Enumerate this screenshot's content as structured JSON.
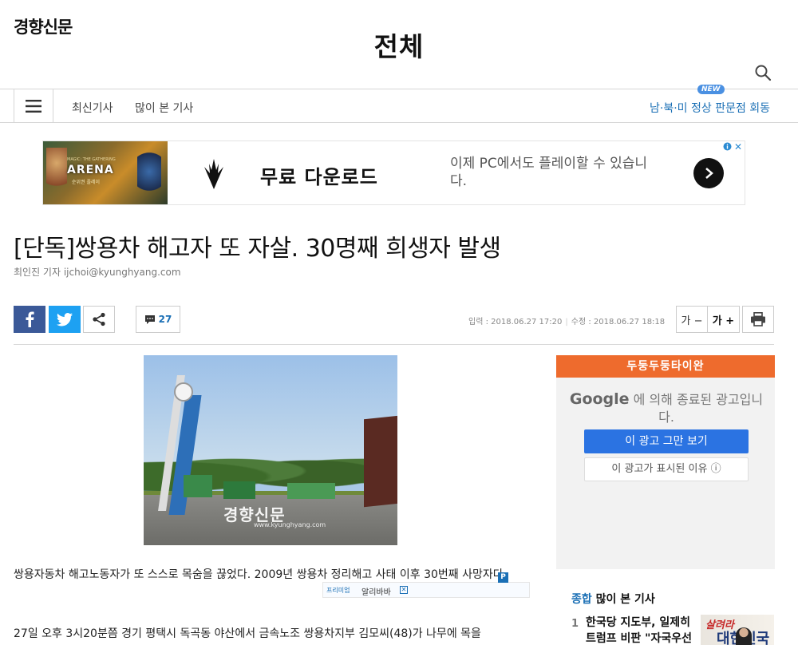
{
  "header": {
    "logo": "경향신문",
    "section_title": "전체"
  },
  "nav": {
    "latest": "최신기사",
    "most_viewed": "많이 본 기사",
    "hot_topic": "남·북·미 정상 판문점 회동",
    "new_badge": "NEW"
  },
  "banner_ad": {
    "image_text": "ARENA",
    "image_top_text": "MAGIC: THE GATHERING",
    "image_sub_text": "순위권 플레이",
    "headline": "무료 다운로드",
    "description": "이제 PC에서도 플레이할 수 있습니다.",
    "close": "✕"
  },
  "article": {
    "headline": "[단독]쌍용차 해고자 또 자살. 30명째 희생자 발생",
    "byline": "최인진 기자 ijchoi@kyunghyang.com",
    "comment_count": "27",
    "date_input": "입력 : 2018.06.27 17:20",
    "date_modified": "수정 : 2018.06.27 18:18",
    "font_decrease": "가 −",
    "font_increase": "가 +",
    "photo_watermark": "경향신문",
    "photo_watermark_url": "www.kyunghyang.com",
    "paragraph1": "쌍용자동차 해고노동자가 또 스스로 목숨을 끊었다. 2009년 쌍용차 정리해고 사태 이후 30번째 사망자다.",
    "paragraph2": "27일 오후 3시20분쯤 경기 평택시 독곡동 야산에서 금속노조 쌍용차지부 김모씨(48)가 나무에 목을"
  },
  "inline_ad": {
    "tag": "프리미엄",
    "name": "알리바바",
    "close": "✕",
    "p_label": "P"
  },
  "side_ad": {
    "top_text": "두둥두둥타이완",
    "google": "Google",
    "message": "에 의해 종료된 광고입니다.",
    "stop_button": "이 광고 그만 보기",
    "why_button": "이 광고가 표시된 이유 ⓘ"
  },
  "popular": {
    "category": "종합",
    "title": "많이 본 기사",
    "items": [
      {
        "num": "1",
        "text": "한국당 지도부, 일제히 트럼프 비판 \"자국우선",
        "thumb_text1": "살려라",
        "thumb_text2": "대한민국"
      }
    ]
  },
  "colors": {
    "facebook": "#3b5998",
    "twitter": "#1da1f2",
    "accent_blue": "#1a6fb5",
    "side_ad_orange": "#ee6b2d",
    "google_button": "#2b73e2"
  },
  "icons": {
    "search": "search-icon",
    "menu": "hamburger-icon",
    "facebook": "facebook-icon",
    "twitter": "twitter-icon",
    "share": "share-icon",
    "comment": "comment-icon",
    "print": "printer-icon",
    "arrow": "chevron-right-icon",
    "info": "info-icon",
    "brand": "planeswalker-icon"
  }
}
